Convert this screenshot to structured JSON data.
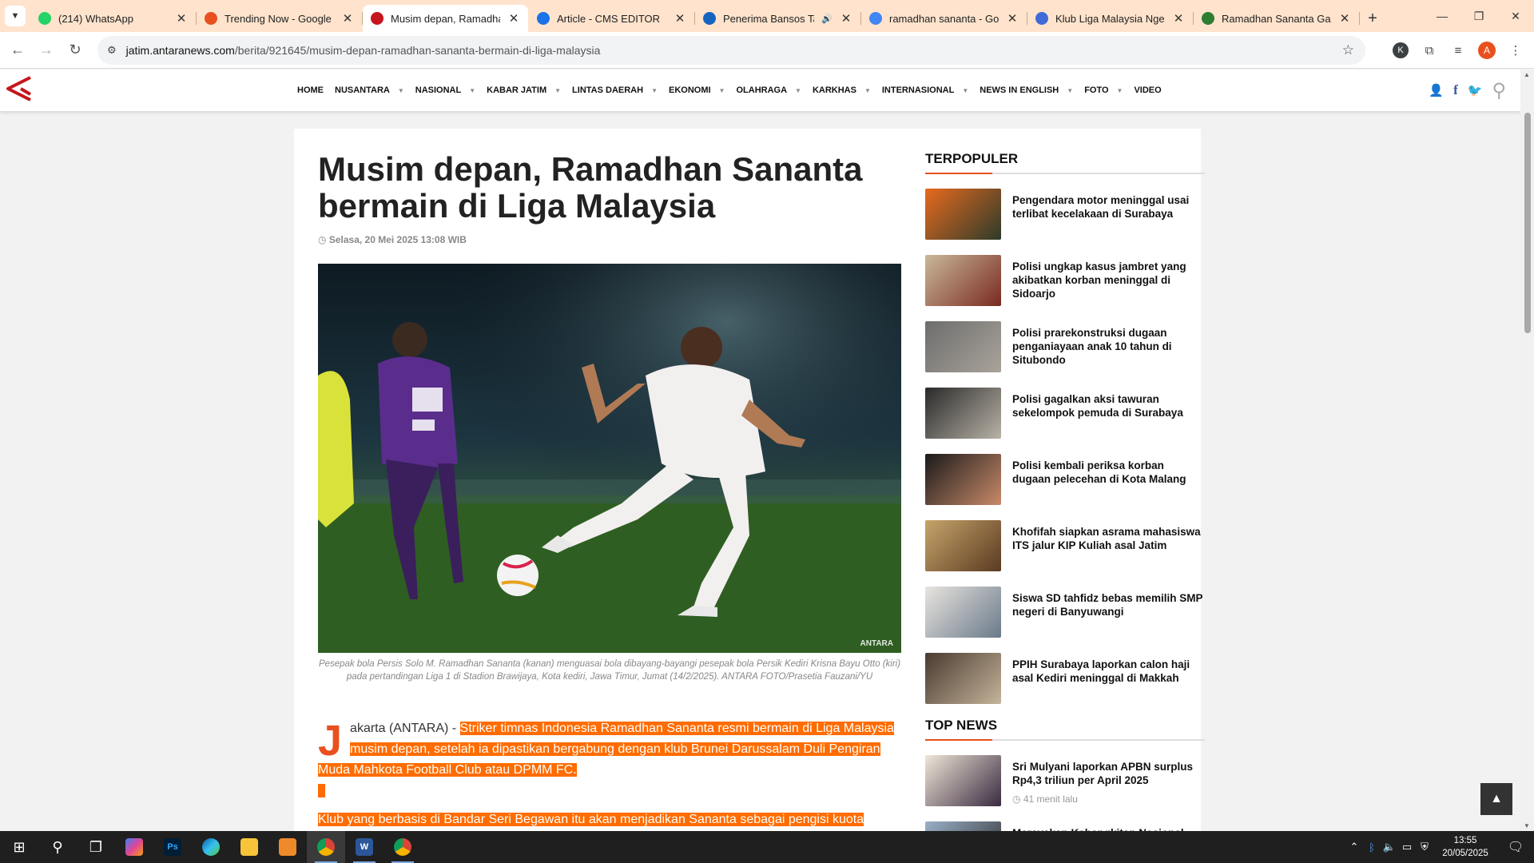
{
  "browser": {
    "tabs": [
      {
        "title": "(214) WhatsApp",
        "favicon_color": "#25d366",
        "active": false
      },
      {
        "title": "Trending Now - Google Trends",
        "favicon_color": "#e8501e",
        "active": false
      },
      {
        "title": "Musim depan, Ramadhan Sananta",
        "favicon_color": "#c4161c",
        "active": true
      },
      {
        "title": "Article - CMS EDITOR",
        "favicon_color": "#1a73e8",
        "active": false
      },
      {
        "title": "Penerima Bansos Tahap",
        "favicon_color": "#1565c0",
        "active": false,
        "muted_icon": "🔊"
      },
      {
        "title": "ramadhan sananta - Google",
        "favicon_color": "#4285f4",
        "active": false
      },
      {
        "title": "Klub Liga Malaysia Ngebet",
        "favicon_color": "#3f6ad8",
        "active": false
      },
      {
        "title": "Ramadhan Sananta Gabung",
        "favicon_color": "#2e7d32",
        "active": false
      }
    ],
    "new_tab_icon": "plus-icon",
    "url_domain": "jatim.antaranews.com",
    "url_path": "/berita/921645/musim-depan-ramadhan-sananta-bermain-di-liga-malaysia",
    "profile_k": "K",
    "profile_a": "A"
  },
  "site": {
    "brand_color": "#c4161c",
    "menu": [
      {
        "label": "HOME",
        "caret": false
      },
      {
        "label": "NUSANTARA",
        "caret": true
      },
      {
        "label": "NASIONAL",
        "caret": true
      },
      {
        "label": "KABAR JATIM",
        "caret": true
      },
      {
        "label": "LINTAS DAERAH",
        "caret": true
      },
      {
        "label": "EKONOMI",
        "caret": true
      },
      {
        "label": "OLAHRAGA",
        "caret": true
      },
      {
        "label": "KARKHAS",
        "caret": true
      },
      {
        "label": "INTERNASIONAL",
        "caret": true
      },
      {
        "label": "NEWS IN ENGLISH",
        "caret": true
      },
      {
        "label": "FOTO",
        "caret": true
      },
      {
        "label": "VIDEO",
        "caret": false
      }
    ]
  },
  "article": {
    "headline": "Musim depan, Ramadhan Sananta bermain di Liga Malaysia",
    "date": "Selasa, 20 Mei 2025 13:08 WIB",
    "photo_watermark": "ANTARA",
    "caption": "Pesepak bola Persis Solo M. Ramadhan Sananta (kanan) menguasai bola dibayang-bayangi pesepak bola Persik Kediri Krisna Bayu Otto (kiri) pada pertandingan Liga 1 di Stadion Brawijaya, Kota kediri, Jawa Timur, Jumat (14/2/2025). ANTARA FOTO/Prasetia Fauzani/YU",
    "dropcap": "J",
    "lead_plain": "akarta (ANTARA) - ",
    "lead_highlight": "Striker timnas Indonesia Ramadhan Sananta resmi bermain di Liga Malaysia musim depan, setelah ia dipastikan bergabung dengan klub Brunei Darussalam Duli Pengiran Muda Mahkota Football Club atau DPMM FC.",
    "para2": "Klub yang berbasis di Bandar Seri Begawan itu akan menjadikan Sananta sebagai pengisi kuota pemain ASEAN mereka."
  },
  "sidebar": {
    "popular_title": "TERPOPULER",
    "popular": [
      {
        "title": "Pengendara motor meninggal usai terlibat kecelakaan di Surabaya"
      },
      {
        "title": "Polisi ungkap kasus jambret yang akibatkan korban meninggal di Sidoarjo"
      },
      {
        "title": "Polisi prarekonstruksi dugaan penganiayaan anak 10 tahun di Situbondo"
      },
      {
        "title": "Polisi gagalkan aksi tawuran sekelompok pemuda di Surabaya"
      },
      {
        "title": "Polisi kembali periksa korban dugaan pelecehan di Kota Malang"
      },
      {
        "title": "Khofifah siapkan asrama mahasiswa ITS jalur KIP Kuliah asal Jatim"
      },
      {
        "title": "Siswa SD tahfidz bebas memilih SMP negeri di Banyuwangi"
      },
      {
        "title": "PPIH Surabaya laporkan calon haji asal Kediri meninggal di Makkah"
      }
    ],
    "top_title": "TOP NEWS",
    "top": [
      {
        "title": "Sri Mulyani laporkan APBN surplus Rp4,3 triliun per April 2025",
        "meta": "41 menit lalu"
      },
      {
        "title": "Merayakan Kebangkitan Nasional",
        "meta": ""
      }
    ]
  },
  "taskbar": {
    "time": "13:55",
    "date": "20/05/2025"
  }
}
